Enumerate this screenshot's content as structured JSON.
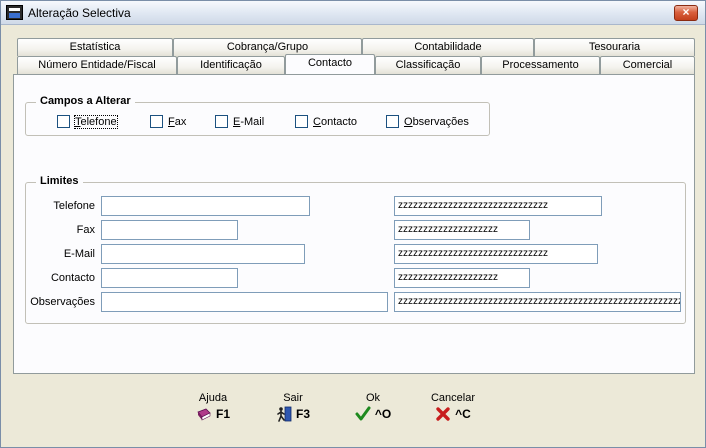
{
  "window": {
    "title": "Alteração Selectiva",
    "close_label": "×"
  },
  "tabs_row1": [
    {
      "label": "Estatística"
    },
    {
      "label": "Cobrança/Grupo"
    },
    {
      "label": "Contabilidade"
    },
    {
      "label": "Tesouraria"
    }
  ],
  "tabs_row2": [
    {
      "label": "Número Entidade/Fiscal"
    },
    {
      "label": "Identificação"
    },
    {
      "label": "Contacto",
      "active": true
    },
    {
      "label": "Classificação"
    },
    {
      "label": "Processamento"
    },
    {
      "label": "Comercial"
    }
  ],
  "campos": {
    "title": "Campos a Alterar",
    "checkboxes": [
      {
        "accel": "T",
        "rest": "elefone",
        "checked": false
      },
      {
        "accel": "F",
        "rest": "ax",
        "checked": false
      },
      {
        "accel": "E",
        "rest": "-Mail",
        "checked": false
      },
      {
        "accel": "C",
        "rest": "ontacto",
        "checked": false
      },
      {
        "accel": "O",
        "rest": "bservações",
        "checked": false
      }
    ]
  },
  "limites": {
    "title": "Limites",
    "rows": [
      {
        "label": "Telefone",
        "from": "",
        "to": "zzzzzzzzzzzzzzzzzzzzzzzzzzzzzz"
      },
      {
        "label": "Fax",
        "from": "",
        "to": "zzzzzzzzzzzzzzzzzzzz"
      },
      {
        "label": "E-Mail",
        "from": "",
        "to": "zzzzzzzzzzzzzzzzzzzzzzzzzzzzzz"
      },
      {
        "label": "Contacto",
        "from": "",
        "to": "zzzzzzzzzzzzzzzzzzzz"
      },
      {
        "label": "Observações",
        "from": "",
        "to": "zzzzzzzzzzzzzzzzzzzzzzzzzzzzzzzzzzzzzzzzzzzzzzzzzzzzzzzzzzzz"
      }
    ]
  },
  "footer": {
    "ajuda": {
      "caption": "Ajuda",
      "key": "F1",
      "icon": "book-icon"
    },
    "sair": {
      "caption": "Sair",
      "key": "F3",
      "icon": "exit-door-icon"
    },
    "ok": {
      "caption": "Ok",
      "key": "^O",
      "icon": "green-check-icon"
    },
    "cancelar": {
      "caption": "Cancelar",
      "key": "^C",
      "icon": "red-x-icon"
    }
  },
  "colors": {
    "accent_blue": "#3a6fd0",
    "ok_green": "#1e8a1e",
    "cancel_red": "#c81e1e",
    "tab_border": "#919b9c"
  }
}
